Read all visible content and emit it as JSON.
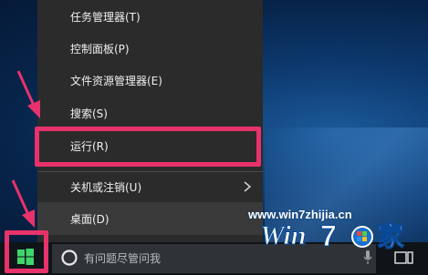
{
  "start_menu": {
    "items": [
      {
        "label": "任务管理器(T)"
      },
      {
        "label": "控制面板(P)"
      },
      {
        "label": "文件资源管理器(E)"
      },
      {
        "label": "搜索(S)"
      },
      {
        "label": "运行(R)"
      },
      {
        "label": "关机或注销(U)"
      },
      {
        "label": "桌面(D)"
      }
    ]
  },
  "taskbar": {
    "search_placeholder": "有问题尽管问我"
  },
  "watermark": {
    "url": "www.win7zhijia.cn"
  },
  "colors": {
    "highlight": "#e8326c",
    "menu_bg": "#2b2b2b",
    "taskbar_bg": "#0f1418",
    "start_logo": "#3fd66b"
  },
  "icons": [
    "windows-logo-icon",
    "cortana-icon",
    "microphone-icon",
    "task-view-icon",
    "chevron-right-icon",
    "arrow-icon"
  ]
}
